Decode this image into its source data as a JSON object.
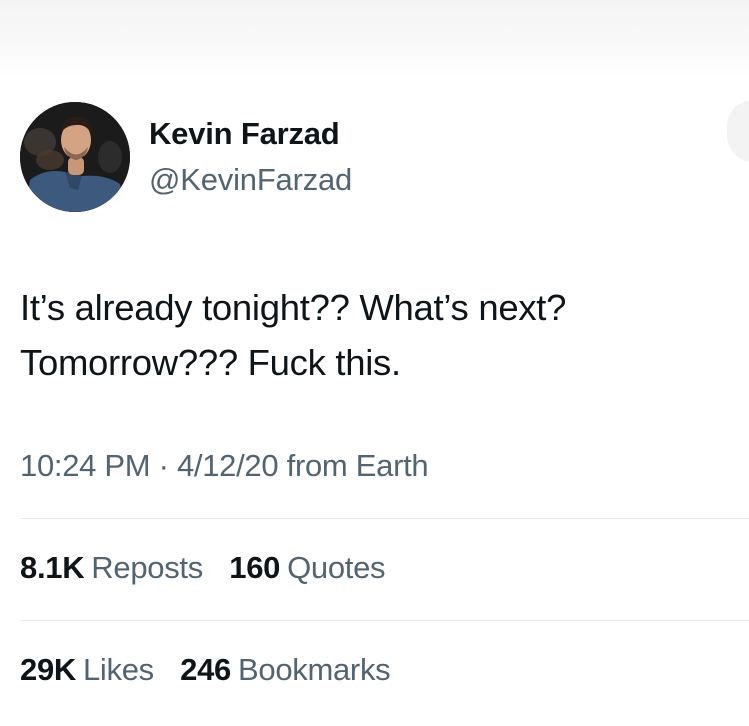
{
  "author": {
    "display_name": "Kevin Farzad",
    "handle": "@KevinFarzad"
  },
  "tweet": {
    "lines": [
      "It’s already tonight?? What’s next?",
      "Tomorrow??? Fuck this."
    ]
  },
  "meta": {
    "time": "10:24 PM",
    "separator": "·",
    "date": "4/12/20",
    "source": "from Earth"
  },
  "stats_row_1": [
    {
      "count": "8.1K",
      "label": "Reposts"
    },
    {
      "count": "160",
      "label": "Quotes"
    }
  ],
  "stats_row_2": [
    {
      "count": "29K",
      "label": "Likes"
    },
    {
      "count": "246",
      "label": "Bookmarks"
    }
  ]
}
